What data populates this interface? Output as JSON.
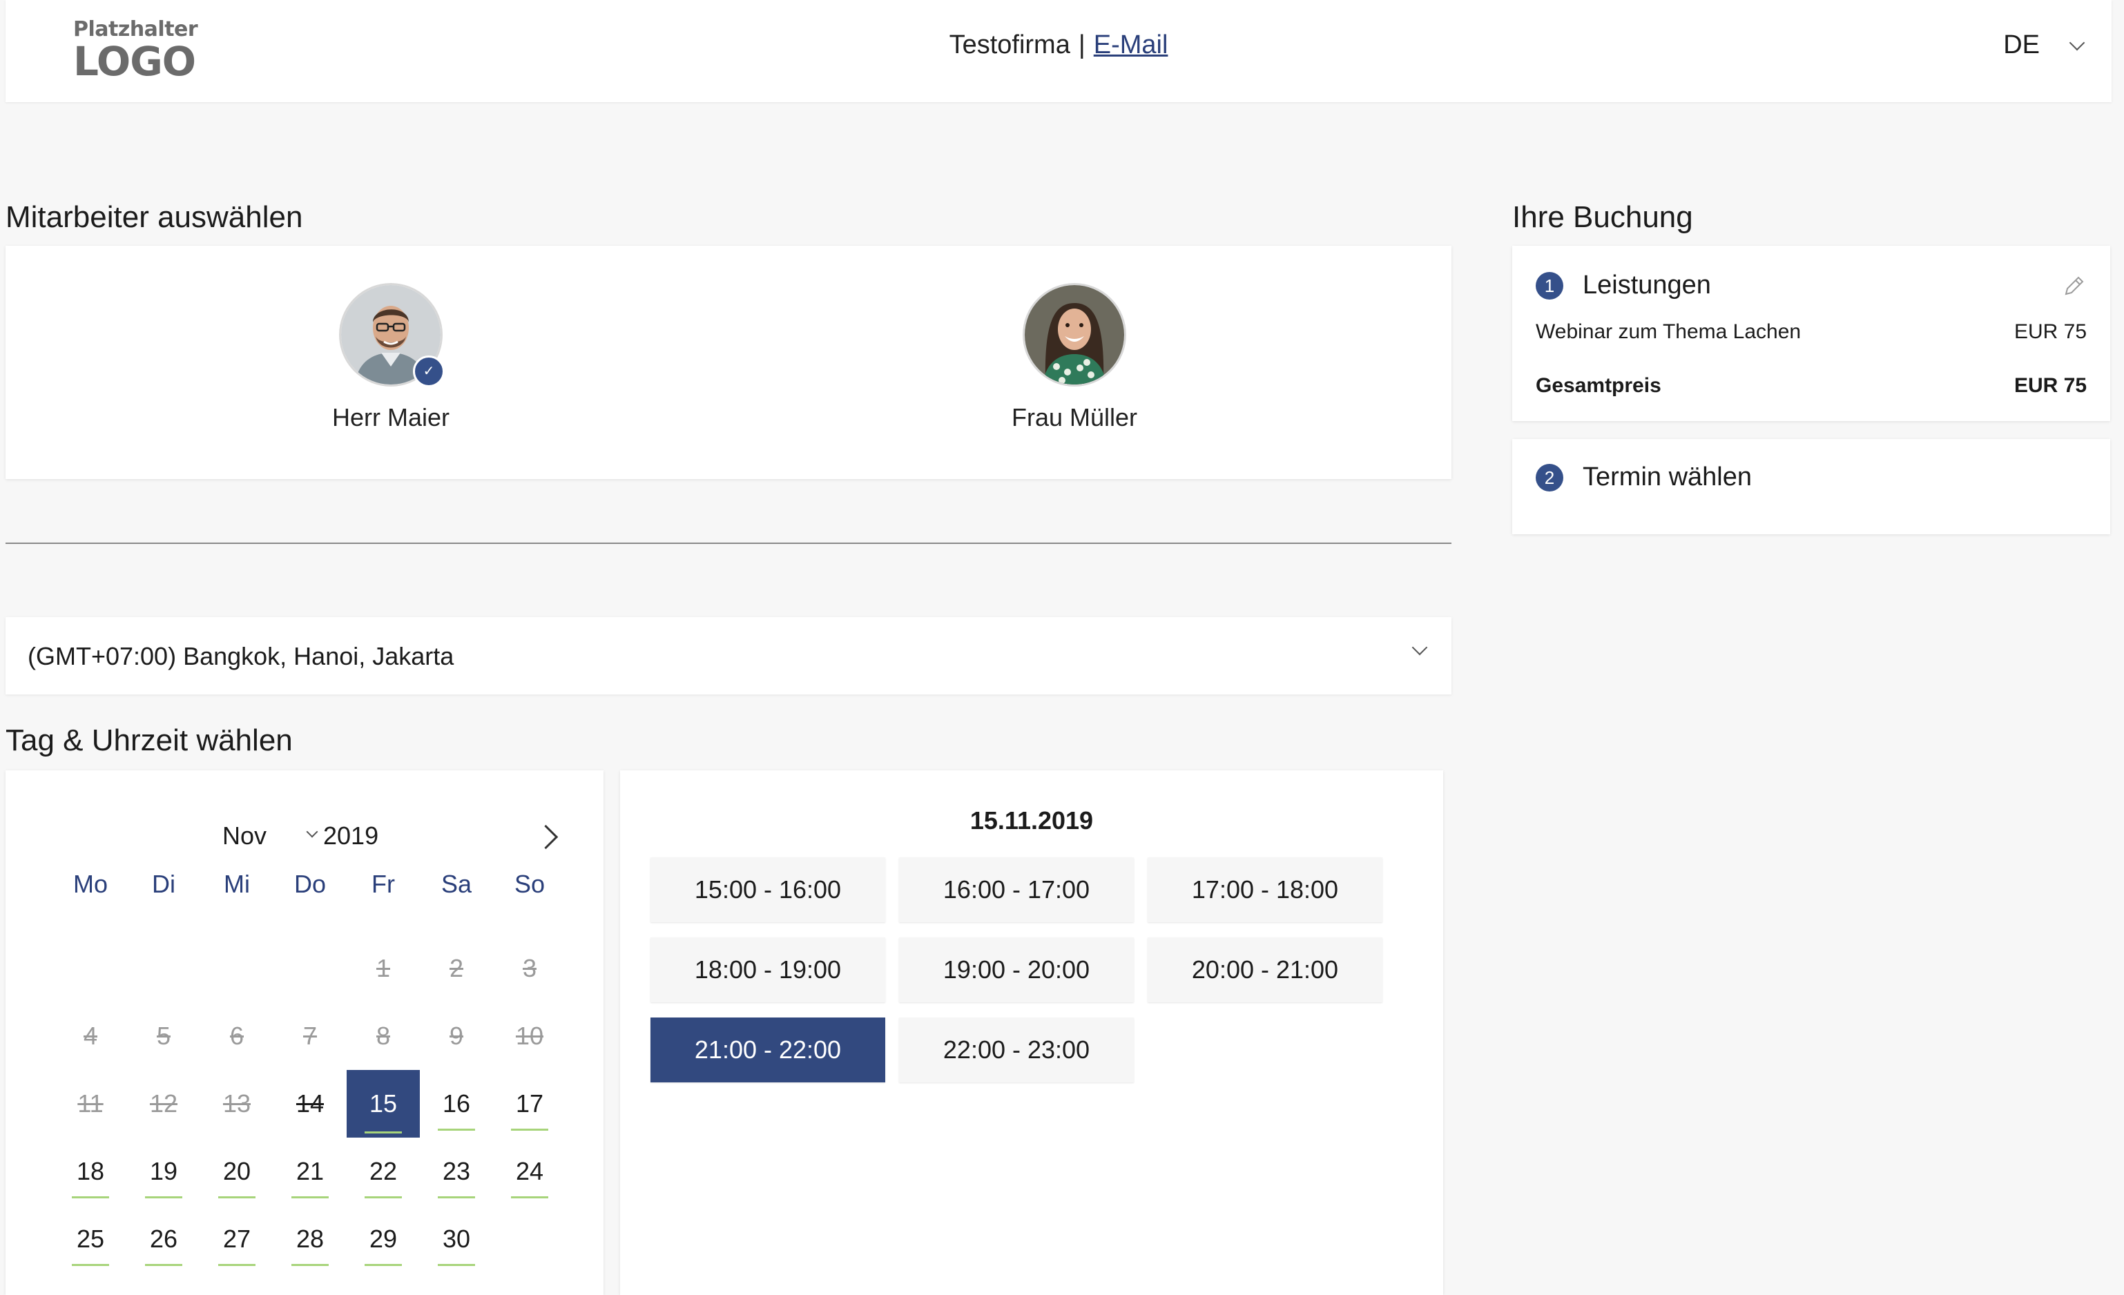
{
  "header": {
    "logo_small": "Platzhalter",
    "logo_big": "LOGO",
    "company": "Testofirma",
    "separator": "|",
    "email_link": "E-Mail",
    "language": "DE"
  },
  "employees": {
    "title": "Mitarbeiter auswählen",
    "items": [
      {
        "name": "Herr Maier",
        "selected": true
      },
      {
        "name": "Frau Müller",
        "selected": false
      }
    ]
  },
  "timezone": {
    "value": "(GMT+07:00) Bangkok, Hanoi, Jakarta"
  },
  "schedule": {
    "title": "Tag & Uhrzeit wählen",
    "month": "Nov",
    "year": "2019",
    "weekdays": [
      "Mo",
      "Di",
      "Mi",
      "Do",
      "Fr",
      "Sa",
      "So"
    ],
    "days": [
      "",
      "",
      "",
      "",
      "1",
      "2",
      "3",
      "4",
      "5",
      "6",
      "7",
      "8",
      "9",
      "10",
      "11",
      "12",
      "13",
      "14",
      "15",
      "16",
      "17",
      "18",
      "19",
      "20",
      "21",
      "22",
      "23",
      "24",
      "25",
      "26",
      "27",
      "28",
      "29",
      "30",
      ""
    ],
    "selected_date": "15.11.2019",
    "slots": [
      "15:00 - 16:00",
      "16:00 - 17:00",
      "17:00 - 18:00",
      "18:00 - 19:00",
      "19:00 - 20:00",
      "20:00 - 21:00",
      "21:00 - 22:00",
      "22:00 - 23:00"
    ],
    "selected_slot": "21:00 - 22:00"
  },
  "booking": {
    "title": "Ihre Buchung",
    "step1": {
      "number": "1",
      "label": "Leistungen",
      "service": "Webinar zum Thema Lachen",
      "service_price": "EUR 75",
      "total_label": "Gesamtpreis",
      "total_price": "EUR 75"
    },
    "step2": {
      "number": "2",
      "label": "Termin wählen"
    }
  },
  "colors": {
    "accent": "#32497f",
    "available_underline": "#a7d47a",
    "background": "#f7f7f7"
  }
}
